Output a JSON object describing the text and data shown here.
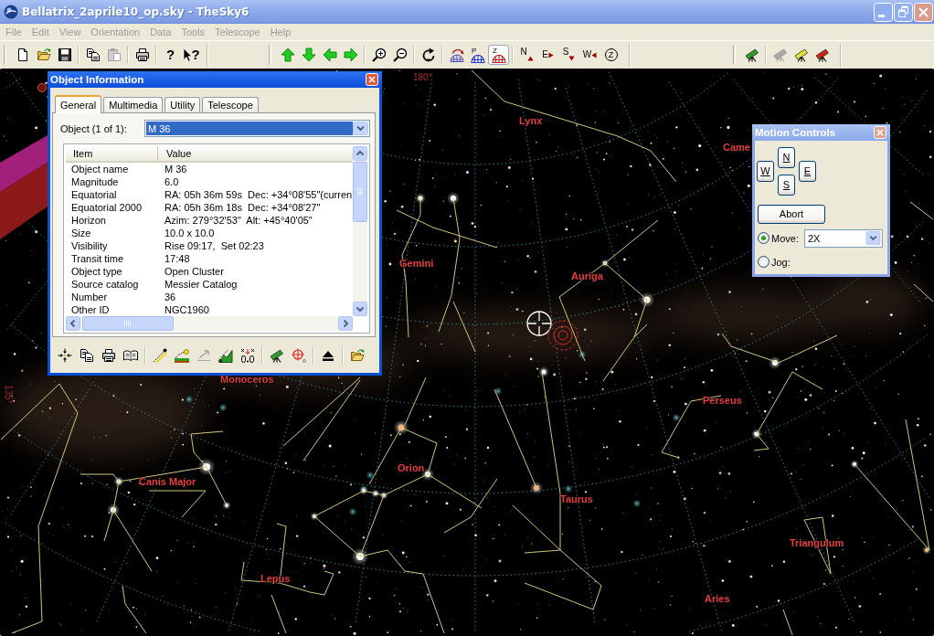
{
  "window": {
    "title": "Bellatrix_2aprile10_op.sky - TheSky6",
    "active": false
  },
  "menu": [
    {
      "label": "File",
      "disabled": true
    },
    {
      "label": "Edit",
      "disabled": true
    },
    {
      "label": "View",
      "disabled": true
    },
    {
      "label": "Orientation",
      "disabled": true
    },
    {
      "label": "Data",
      "disabled": true
    },
    {
      "label": "Tools",
      "disabled": true
    },
    {
      "label": "Telescope",
      "disabled": true
    },
    {
      "label": "Help",
      "disabled": true
    }
  ],
  "toolbar": [
    {
      "groups": [
        [
          {
            "kind": "new",
            "disabled": false,
            "pressed": false
          },
          {
            "kind": "open",
            "disabled": false,
            "pressed": false
          },
          {
            "kind": "save",
            "disabled": false,
            "pressed": false
          }
        ],
        [
          {
            "kind": "copy",
            "disabled": false,
            "pressed": false
          },
          {
            "kind": "paste",
            "disabled": true,
            "pressed": false
          }
        ],
        [
          {
            "kind": "print",
            "disabled": false,
            "pressed": false
          }
        ],
        [
          {
            "kind": "help",
            "label": "?",
            "disabled": false,
            "pressed": false
          },
          {
            "kind": "whatsthis",
            "label": "?",
            "disabled": false,
            "pressed": false
          }
        ]
      ]
    },
    {
      "groups": [
        [
          {
            "kind": "up",
            "disabled": false,
            "pressed": false
          },
          {
            "kind": "down",
            "disabled": false,
            "pressed": false
          },
          {
            "kind": "left",
            "disabled": false,
            "pressed": false
          },
          {
            "kind": "right",
            "disabled": false,
            "pressed": false
          }
        ],
        [
          {
            "kind": "zoomin",
            "disabled": false,
            "pressed": false
          },
          {
            "kind": "zoomout",
            "disabled": false,
            "pressed": false
          }
        ],
        [
          {
            "kind": "rotate",
            "disabled": false,
            "pressed": false
          }
        ],
        [
          {
            "kind": "domeflip",
            "disabled": false,
            "pressed": false
          },
          {
            "kind": "dome",
            "label": "P",
            "color": "#2038c0",
            "disabled": false,
            "pressed": false
          },
          {
            "kind": "dome",
            "label": "Z",
            "color": "#c02020",
            "disabled": false,
            "pressed": true
          }
        ],
        [
          {
            "kind": "north",
            "label": "N",
            "disabled": false,
            "pressed": false
          },
          {
            "kind": "east",
            "label": "E",
            "disabled": false,
            "pressed": false
          },
          {
            "kind": "south",
            "label": "S",
            "disabled": false,
            "pressed": false
          },
          {
            "kind": "west",
            "label": "W",
            "disabled": false,
            "pressed": false
          },
          {
            "kind": "zenith",
            "label": "Z",
            "disabled": false,
            "pressed": false
          }
        ]
      ]
    },
    {
      "groups": [
        [
          {
            "kind": "telescope",
            "color": "#2f9a2f",
            "disabled": false,
            "pressed": false
          }
        ],
        [
          {
            "kind": "telescope",
            "color": "#a8a8a8",
            "disabled": true,
            "pressed": false
          },
          {
            "kind": "telescope",
            "color": "#e6dc3a",
            "disabled": false,
            "pressed": false
          },
          {
            "kind": "telescope",
            "color": "#d02020",
            "disabled": false,
            "pressed": false
          }
        ]
      ]
    }
  ],
  "sky": {
    "labels": [
      {
        "text": "180°",
        "kind": "coordinate"
      },
      {
        "text": "Lynx",
        "kind": "constellation"
      },
      {
        "text": "Came",
        "kind": "constellation"
      },
      {
        "text": "Gemini",
        "kind": "constellation"
      },
      {
        "text": "Auriga",
        "kind": "constellation"
      },
      {
        "text": "Monoceros",
        "kind": "constellation"
      },
      {
        "text": "135°",
        "kind": "coordinate"
      },
      {
        "text": "Perseus",
        "kind": "constellation"
      },
      {
        "text": "Orion",
        "kind": "constellation"
      },
      {
        "text": "Canis Major",
        "kind": "constellation"
      },
      {
        "text": "Taurus",
        "kind": "constellation"
      },
      {
        "text": "Triangulum",
        "kind": "constellation"
      },
      {
        "text": "Lepus",
        "kind": "constellation"
      },
      {
        "text": "Aries",
        "kind": "constellation"
      }
    ]
  },
  "object_info": {
    "title": "Object Information",
    "active": true,
    "tabs": [
      {
        "label": "General",
        "selected": true
      },
      {
        "label": "Multimedia",
        "selected": false
      },
      {
        "label": "Utility",
        "selected": false
      },
      {
        "label": "Telescope",
        "selected": false
      }
    ],
    "object_label": "Object (1 of 1):",
    "object_value": "M 36",
    "columns": [
      "Item",
      "Value"
    ],
    "rows": [
      {
        "item": "Object name",
        "value": "M 36"
      },
      {
        "item": "Magnitude",
        "value": "6.0"
      },
      {
        "item": "Equatorial",
        "value": "RA: 05h 36m 59s  Dec: +34°08'55\"(curren"
      },
      {
        "item": "Equatorial 2000",
        "value": "RA: 05h 36m 18s  Dec: +34°08'27\""
      },
      {
        "item": "Horizon",
        "value": "Azim: 279°32'53\"  Alt: +45°40'05\""
      },
      {
        "item": "Size",
        "value": "10.0 x 10.0"
      },
      {
        "item": "Visibility",
        "value": "Rise 09:17,  Set 02:23"
      },
      {
        "item": "Transit time",
        "value": "17:48"
      },
      {
        "item": "Object type",
        "value": "Open Cluster"
      },
      {
        "item": "Source catalog",
        "value": "Messier Catalog"
      },
      {
        "item": "Number",
        "value": "36"
      },
      {
        "item": "Other ID",
        "value": "NGC1960"
      }
    ],
    "tools": [
      [
        {
          "kind": "center",
          "disabled": false
        },
        {
          "kind": "copy",
          "disabled": false
        },
        {
          "kind": "print",
          "disabled": false
        },
        {
          "kind": "book",
          "disabled": false
        }
      ],
      [
        {
          "kind": "path",
          "disabled": false
        },
        {
          "kind": "horizon",
          "disabled": false
        },
        {
          "kind": "slew",
          "disabled": true
        },
        {
          "kind": "mount",
          "disabled": false
        },
        {
          "kind": "numbers",
          "disabled": false
        }
      ],
      [
        {
          "kind": "telescope",
          "disabled": false
        },
        {
          "kind": "target",
          "disabled": false
        }
      ],
      [
        {
          "kind": "eject",
          "disabled": false
        }
      ],
      [
        {
          "kind": "open",
          "disabled": false
        }
      ]
    ]
  },
  "motion_controls": {
    "title": "Motion Controls",
    "active": false,
    "directions": [
      {
        "label": "N"
      },
      {
        "label": "W"
      },
      {
        "label": "E"
      },
      {
        "label": "S"
      }
    ],
    "abort": "Abort",
    "modes": [
      {
        "label": "Move:",
        "selected": true,
        "value": "2X"
      },
      {
        "label": "Jog:",
        "selected": false
      }
    ]
  }
}
